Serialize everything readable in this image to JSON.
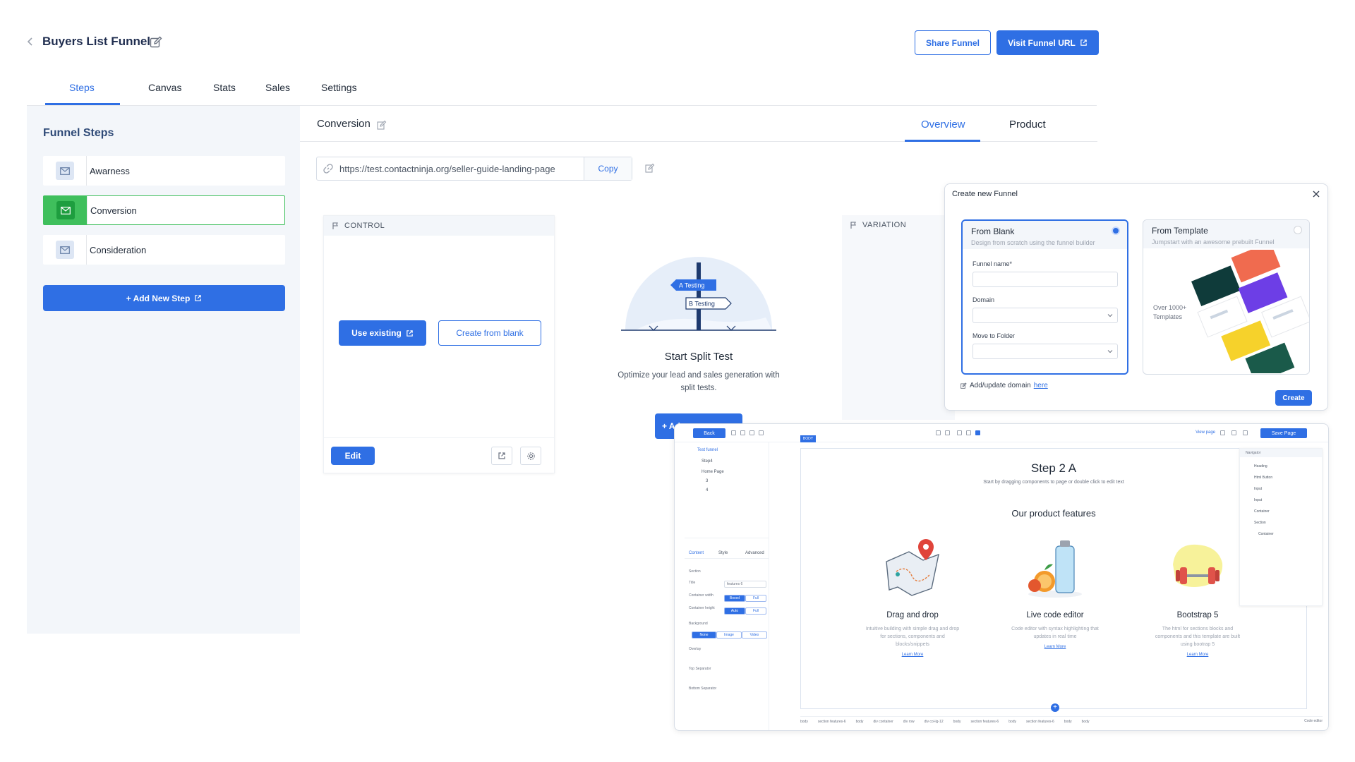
{
  "header": {
    "title": "Buyers List Funnel",
    "share_label": "Share Funnel",
    "visit_label": "Visit Funnel URL"
  },
  "tabs": [
    {
      "label": "Steps",
      "active": true
    },
    {
      "label": "Canvas"
    },
    {
      "label": "Stats"
    },
    {
      "label": "Sales"
    },
    {
      "label": "Settings"
    }
  ],
  "sidebar": {
    "heading": "Funnel Steps",
    "steps": [
      {
        "label": "Awarness",
        "icon": "mail-icon"
      },
      {
        "label": "Conversion",
        "icon": "mail-icon",
        "active": true
      },
      {
        "label": "Consideration",
        "icon": "mail-icon"
      }
    ],
    "add_label": "+ Add New Step"
  },
  "content": {
    "title": "Conversion",
    "sub_tabs": [
      {
        "label": "Overview",
        "active": true
      },
      {
        "label": "Product"
      }
    ],
    "url": "https://test.contactninja.org/seller-guide-landing-page",
    "copy_label": "Copy"
  },
  "control": {
    "heading": "CONTROL",
    "use_existing_label": "Use existing",
    "create_blank_label": "Create from blank",
    "edit_label": "Edit"
  },
  "split_test": {
    "sign_a": "A Testing",
    "sign_b": "B Testing",
    "title": "Start Split Test",
    "desc": "Optimize your lead and sales generation with split tests.",
    "add_label": "+ Ad"
  },
  "variation": {
    "heading": "VARIATION"
  },
  "modal": {
    "title": "Create new Funnel",
    "blank": {
      "title": "From Blank",
      "subtitle": "Design from scratch using the funnel builder",
      "funnel_name_label": "Funnel name*",
      "domain_label": "Domain",
      "folder_label": "Move to Folder"
    },
    "template": {
      "title": "From Template",
      "subtitle": "Jumpstart with an awesome prebuilt Funnel",
      "count_text": "Over 1000+ Templates"
    },
    "domain_note": "Add/update domain",
    "domain_link": "here",
    "create_label": "Create"
  },
  "editor": {
    "back_label": "Back",
    "save_label": "Save Page",
    "view_page_label": "View page",
    "tree": [
      "Test funnel",
      "Step4",
      "Home Page",
      "3",
      "4"
    ],
    "prop_tabs": [
      "Content",
      "Style",
      "Advanced"
    ],
    "props": {
      "section_label": "Section",
      "title_label": "Title",
      "title_value": "features 6",
      "width_label": "Container width",
      "width_options": [
        "Boxed",
        "Full"
      ],
      "height_label": "Container height",
      "height_options": [
        "Auto",
        "Full"
      ],
      "bg_label": "Background",
      "bg_options": [
        "None",
        "Image",
        "Video"
      ],
      "overlay_label": "Overlay",
      "top_sep_label": "Top Separator",
      "bottom_sep_label": "Bottom Separator"
    },
    "body_badge": "BODY",
    "step_title": "Step 2 A",
    "step_sub": "Start by dragging components to page or double click to edit text",
    "features_title": "Our product features",
    "features": [
      {
        "title": "Drag and drop",
        "desc": "Intuitive building with simple drag and drop for sections, components and blocks/snippets",
        "link": "Learn More"
      },
      {
        "title": "Live code editor",
        "desc": "Code editor with syntax highlighting that updates in real time",
        "link": "Learn More"
      },
      {
        "title": "Bootstrap 5",
        "desc": "The html for sections blocks and components and this template are built using bootrap 5",
        "link": "Learn More"
      }
    ],
    "navigator_label": "Navigator",
    "navigator": [
      "Heading",
      "Html Button",
      "Input",
      "Input",
      "Container",
      "Section",
      "Container"
    ],
    "breadcrumbs": [
      "body",
      "section features-6",
      "body",
      "div container",
      "div row",
      "div col-lg-12",
      "body",
      "section features-6",
      "body",
      "section features-6",
      "body",
      "body"
    ],
    "code_editor_label": "Code editor"
  },
  "colors": {
    "primary": "#2f6fe4",
    "success": "#3fbf5c",
    "sidebar_bg": "#f3f6fa",
    "heading": "#2f4a77"
  }
}
